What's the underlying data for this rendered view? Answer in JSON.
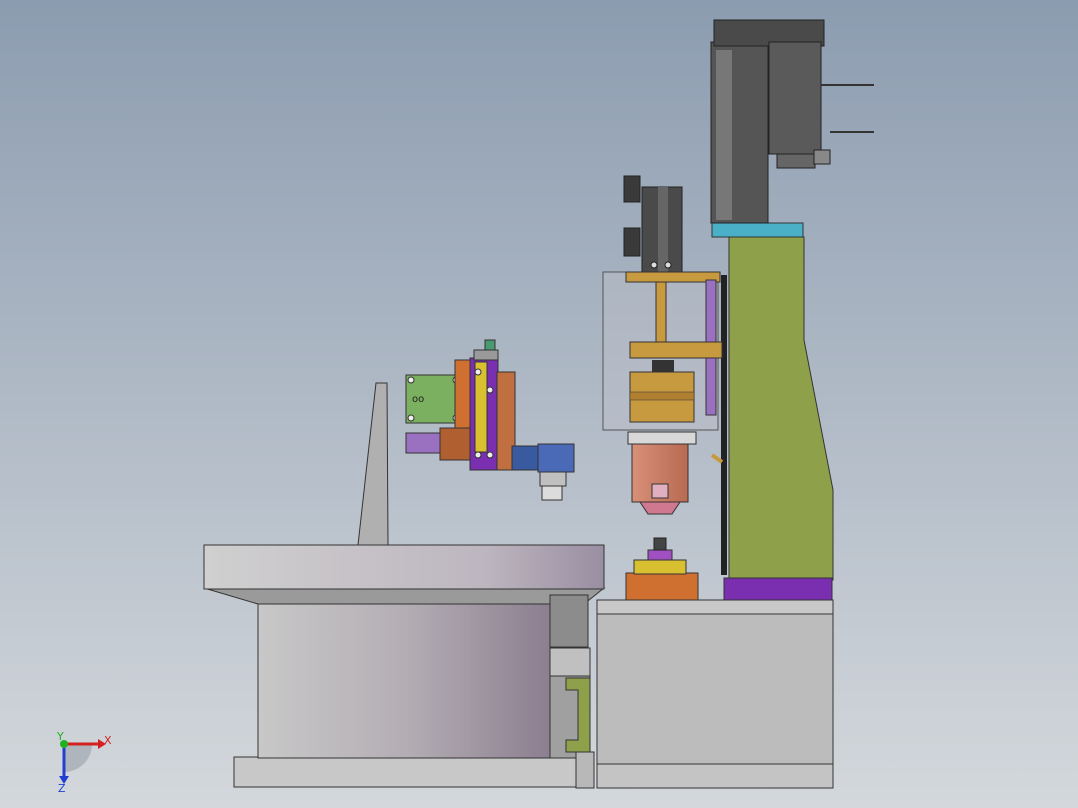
{
  "viewport": {
    "background_top": "#8c9cb0",
    "background_bottom": "#d4d8dc"
  },
  "triad": {
    "x_label": "X",
    "y_label": "Y",
    "z_label": "Z",
    "x_color": "#d42020",
    "y_color": "#20b020",
    "z_color": "#2040d0"
  },
  "colors": {
    "metal_gray": "#a8a8a8",
    "dark_gray": "#505050",
    "olive": "#8ea04a",
    "purple": "#7a2fb0",
    "brass": "#c89a40",
    "copper": "#c87a60",
    "cyan": "#4ab0c8",
    "green_pcb": "#7ab060",
    "blue_block": "#3a5aa0",
    "orange": "#d07030",
    "yellow": "#d8c030"
  }
}
